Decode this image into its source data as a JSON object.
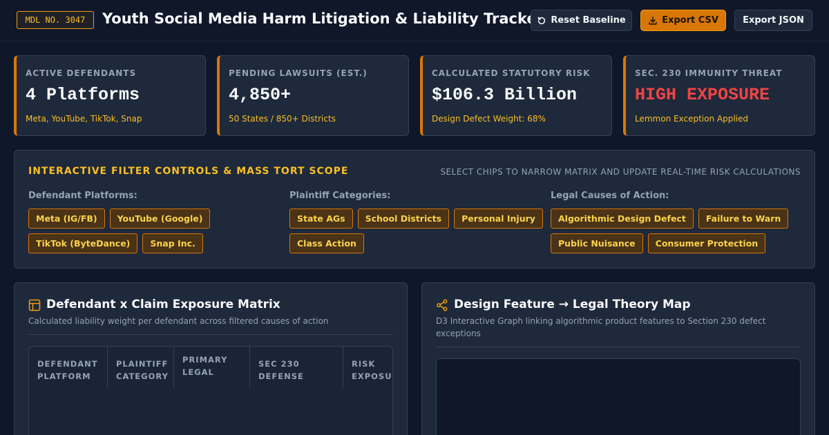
{
  "header": {
    "badge": "MDL NO. 3047",
    "title": "Youth Social Media Harm Litigation & Liability Tracker",
    "buttons": {
      "reset": "Reset Baseline",
      "export_csv": "Export CSV",
      "export_json": "Export JSON"
    }
  },
  "stats": [
    {
      "label": "ACTIVE DEFENDANTS",
      "value": "4 Platforms",
      "sub": "Meta, YouTube, TikTok, Snap"
    },
    {
      "label": "PENDING LAWSUITS (EST.)",
      "value": "4,850+",
      "sub": "50 States / 850+ Districts"
    },
    {
      "label": "CALCULATED STATUTORY RISK",
      "value": "$106.3 Billion",
      "sub": "Design Defect Weight: 68%"
    },
    {
      "label": "SEC. 230 IMMUNITY THREAT",
      "value": "HIGH EXPOSURE",
      "sub": "Lemmon Exception Applied"
    }
  ],
  "filters": {
    "title": "INTERACTIVE FILTER CONTROLS & MASS TORT SCOPE",
    "hint": "SELECT CHIPS TO NARROW MATRIX AND UPDATE REAL-TIME RISK CALCULATIONS",
    "groups": [
      {
        "label": "Defendant Platforms:",
        "chips": [
          "Meta (IG/FB)",
          "YouTube (Google)",
          "TikTok (ByteDance)",
          "Snap Inc."
        ]
      },
      {
        "label": "Plaintiff Categories:",
        "chips": [
          "State AGs",
          "School Districts",
          "Personal Injury",
          "Class Action"
        ]
      },
      {
        "label": "Legal Causes of Action:",
        "chips": [
          "Algorithmic Design Defect",
          "Failure to Warn",
          "Public Nuisance",
          "Consumer Protection"
        ]
      }
    ]
  },
  "matrix": {
    "title": "Defendant x Claim Exposure Matrix",
    "desc": "Calculated liability weight per defendant across filtered causes of action",
    "columns": [
      "DEFENDANT PLATFORM",
      "PLAINTIFF CATEGORY",
      "PRIMARY LEGAL",
      "SEC 230 DEFENSE",
      "RISK EXPOSURE"
    ]
  },
  "graph": {
    "title": "Design Feature → Legal Theory Map",
    "desc": "D3 Interactive Graph linking algorithmic product features to Section 230 defect exceptions"
  },
  "colors": {
    "accent": "#d97706",
    "accent_text": "#fbbf24",
    "danger": "#ef4444",
    "background": "#0f172a",
    "card": "#1e293b"
  }
}
